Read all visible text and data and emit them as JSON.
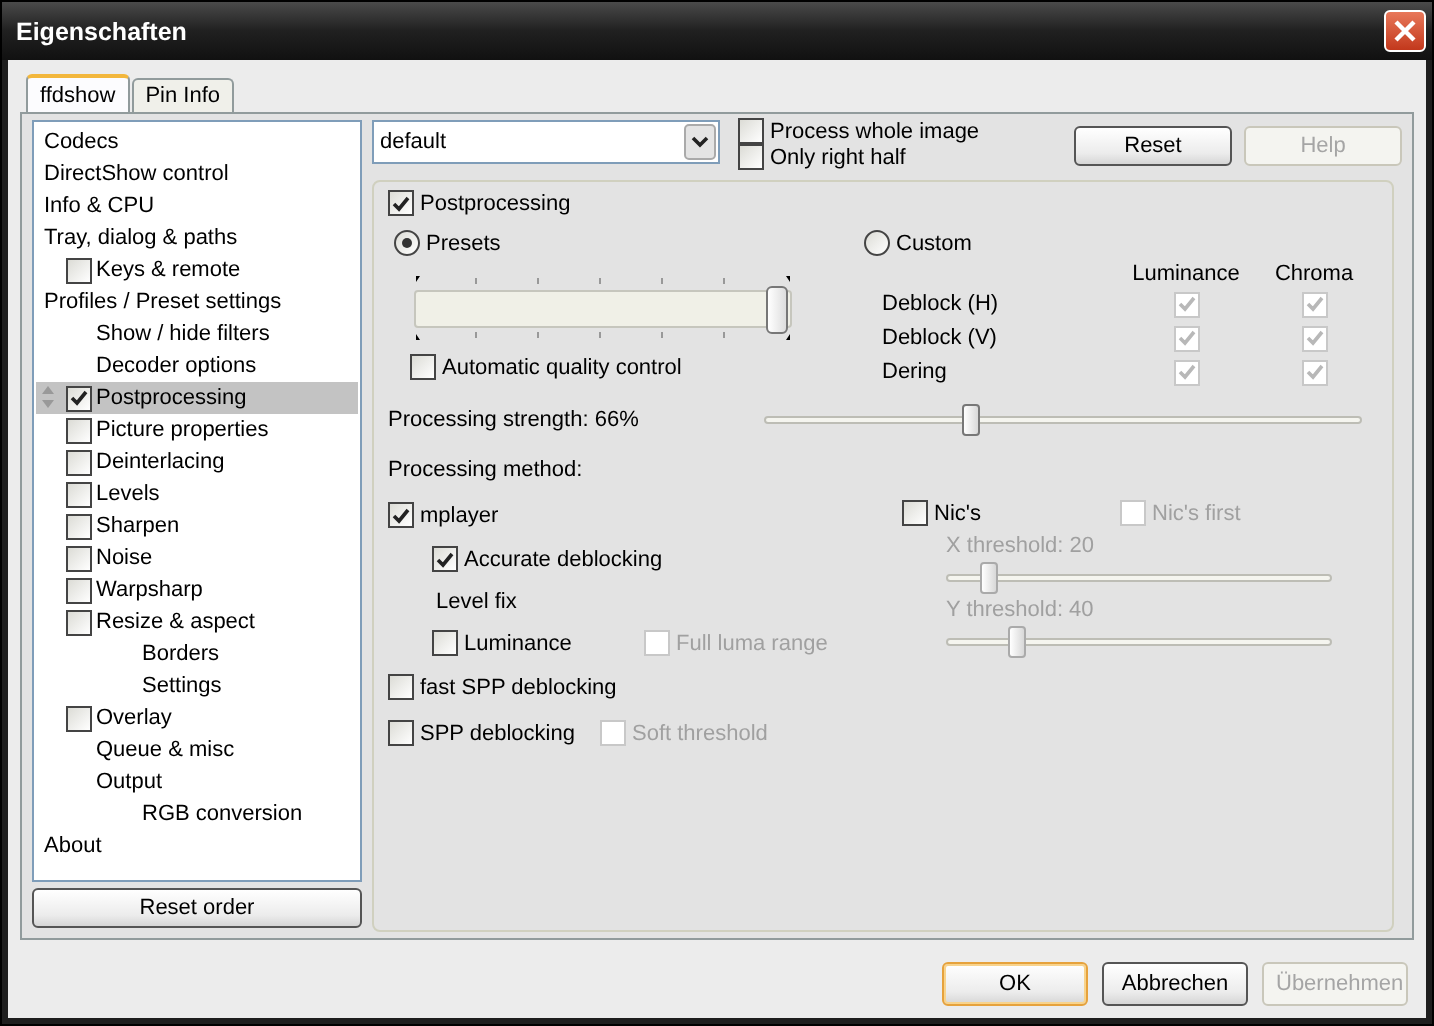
{
  "window": {
    "title": "Eigenschaften"
  },
  "tabs": [
    {
      "label": "ffdshow",
      "selected": true
    },
    {
      "label": "Pin Info",
      "selected": false
    }
  ],
  "tree": [
    {
      "kind": "text",
      "label": "Codecs",
      "selected": false
    },
    {
      "kind": "text",
      "label": "DirectShow control",
      "selected": false
    },
    {
      "kind": "text",
      "label": "Info & CPU",
      "selected": false
    },
    {
      "kind": "text",
      "label": "Tray, dialog & paths",
      "selected": false,
      "children": [
        {
          "kind": "checkbox",
          "label": "Keys & remote",
          "checked": false,
          "selected": false
        }
      ]
    },
    {
      "kind": "text",
      "label": "Profiles / Preset settings",
      "selected": false,
      "children": [
        {
          "kind": "text",
          "label": "Show / hide filters",
          "selected": false
        },
        {
          "kind": "text",
          "label": "Decoder options",
          "selected": false
        },
        {
          "kind": "checkbox",
          "label": "Postprocessing",
          "checked": true,
          "selected": true
        },
        {
          "kind": "checkbox",
          "label": "Picture properties",
          "checked": false,
          "selected": false
        },
        {
          "kind": "checkbox",
          "label": "Deinterlacing",
          "checked": false,
          "selected": false
        },
        {
          "kind": "checkbox",
          "label": "Levels",
          "checked": false,
          "selected": false
        },
        {
          "kind": "checkbox",
          "label": "Sharpen",
          "checked": false,
          "selected": false
        },
        {
          "kind": "checkbox",
          "label": "Noise",
          "checked": false,
          "selected": false
        },
        {
          "kind": "checkbox",
          "label": "Warpsharp",
          "checked": false,
          "selected": false
        },
        {
          "kind": "checkbox",
          "label": "Resize & aspect",
          "checked": false,
          "selected": false,
          "children": [
            {
              "kind": "text",
              "label": "Borders",
              "selected": false
            },
            {
              "kind": "text",
              "label": "Settings",
              "selected": false
            }
          ]
        },
        {
          "kind": "checkbox",
          "label": "Overlay",
          "checked": false,
          "selected": false
        },
        {
          "kind": "text",
          "label": "Queue & misc",
          "selected": false
        },
        {
          "kind": "text",
          "label": "Output",
          "selected": false,
          "children": [
            {
              "kind": "text",
              "label": "RGB conversion",
              "selected": false
            }
          ]
        }
      ]
    },
    {
      "kind": "text",
      "label": "About",
      "selected": false
    }
  ],
  "reset_order_button": "Reset order",
  "profile_select": {
    "value": "default"
  },
  "options": [
    {
      "label": "Process whole image",
      "checked": false
    },
    {
      "label": "Only right half",
      "checked": false
    }
  ],
  "top_buttons": [
    {
      "label": "Reset",
      "disabled": false
    },
    {
      "label": "Help",
      "disabled": true
    }
  ],
  "group": {
    "label": "Postprocessing",
    "checked": true
  },
  "modes": [
    {
      "label": "Presets",
      "selected": true
    },
    {
      "label": "Custom",
      "selected": false
    }
  ],
  "preset_slider": {
    "level": 1
  },
  "auto_quality": {
    "label": "Automatic quality control",
    "checked": false
  },
  "custom_table": {
    "disabled": true,
    "columns": [
      "Luminance",
      "Chroma"
    ],
    "rows": [
      {
        "label": "Deblock (H)",
        "values": [
          true,
          true
        ]
      },
      {
        "label": "Deblock (V)",
        "values": [
          true,
          true
        ]
      },
      {
        "label": "Dering",
        "values": [
          true,
          true
        ]
      }
    ]
  },
  "strength": {
    "label": "Processing strength: 66%",
    "level": 0.34
  },
  "method_label": "Processing method:",
  "method_rows": [
    {
      "kind": "option",
      "items": [
        {
          "label": "mplayer",
          "checked": true,
          "disabled": false
        }
      ],
      "children": [
        {
          "kind": "option",
          "items": [
            {
              "label": "Accurate deblocking",
              "checked": true,
              "disabled": false
            }
          ]
        },
        {
          "kind": "label",
          "label": "Level fix"
        },
        {
          "kind": "option",
          "items": [
            {
              "label": "Luminance",
              "checked": false,
              "disabled": false
            },
            {
              "label": "Full luma range",
              "checked": false,
              "disabled": true
            }
          ]
        }
      ]
    },
    {
      "kind": "option",
      "items": [
        {
          "label": "fast SPP deblocking",
          "checked": false,
          "disabled": false
        }
      ]
    },
    {
      "kind": "option",
      "items": [
        {
          "label": "SPP deblocking",
          "checked": false,
          "disabled": false
        },
        {
          "label": "Soft threshold",
          "checked": false,
          "disabled": true
        }
      ]
    }
  ],
  "nics": [
    {
      "label": "Nic's",
      "checked": false,
      "disabled": false
    },
    {
      "label": "Nic's first",
      "checked": false,
      "disabled": true
    }
  ],
  "thresholds": [
    {
      "label": "X threshold: 20",
      "level": 0.09,
      "disabled": true
    },
    {
      "label": "Y threshold: 40",
      "level": 0.17,
      "disabled": true
    }
  ],
  "buttons": [
    {
      "label": "OK",
      "default": true,
      "disabled": false
    },
    {
      "label": "Abbrechen",
      "default": false,
      "disabled": false
    },
    {
      "label": "Übernehmen",
      "default": false,
      "disabled": true
    }
  ]
}
